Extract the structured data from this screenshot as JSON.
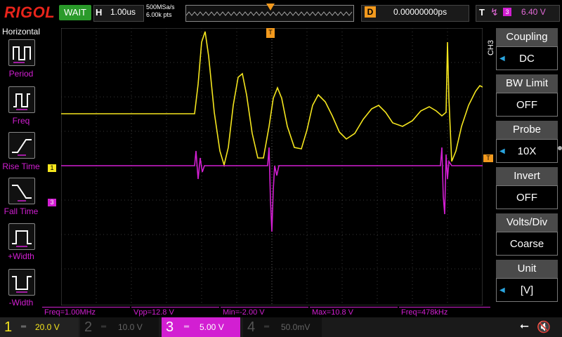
{
  "top": {
    "logo": "RIGOL",
    "status": "WAIT",
    "h_label": "H",
    "h_value": "1.00us",
    "sample_rate": "500MSa/s",
    "mem_depth": "6.00k pts",
    "delay_label": "D",
    "delay_value": "0.00000000ps",
    "trigger_label": "T",
    "trigger_source": "3",
    "trigger_level": "6.40 V"
  },
  "left_menu": {
    "title": "Horizontal",
    "items": [
      "Period",
      "Freq",
      "Rise Time",
      "Fall Time",
      "+Width",
      "-Width"
    ]
  },
  "right_menu": {
    "channel_tag": "CH3",
    "items": [
      {
        "label": "Coupling",
        "value": "DC"
      },
      {
        "label": "BW Limit",
        "value": "OFF"
      },
      {
        "label": "Probe",
        "value": "10X"
      },
      {
        "label": "Invert",
        "value": "OFF"
      },
      {
        "label": "Volts/Div",
        "value": "Coarse"
      },
      {
        "label": "Unit",
        "value": "[V]"
      }
    ]
  },
  "markers": {
    "ch1": "1",
    "ch3": "3",
    "trig_top": "T",
    "trig_right": "T"
  },
  "measurements": [
    {
      "text": "Freq=1.00MHz"
    },
    {
      "text": "Vpp=12.8 V"
    },
    {
      "text": "Min=-2.00 V"
    },
    {
      "text": "Max=10.8 V"
    },
    {
      "text": "Freq=478kHz"
    }
  ],
  "channels": [
    {
      "num": "1",
      "scale": "20.0 V",
      "color": "#f5e61e"
    },
    {
      "num": "2",
      "scale": "10.0 V",
      "color": "#2aa6e0"
    },
    {
      "num": "3",
      "scale": "5.00 V",
      "color": "#d21fd2"
    },
    {
      "num": "4",
      "scale": "50.0mV",
      "color": "#4a7de0"
    }
  ],
  "colors": {
    "ch1": "#f5e61e",
    "ch3": "#d21fd2",
    "trigger": "#f39a1e",
    "accent": "#2aa6e0"
  }
}
